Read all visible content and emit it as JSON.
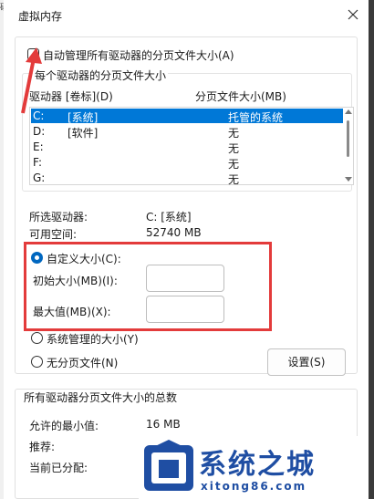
{
  "edge_glyph": "砀",
  "window": {
    "title": "虚拟内存"
  },
  "auto_manage": {
    "label": "自动管理所有驱动器的分页文件大小(A)",
    "checked": false
  },
  "drives_group": {
    "legend": "每个驱动器的分页文件大小",
    "col_drive": "驱动器 [卷标](D)",
    "col_size": "分页文件大小(MB)",
    "rows": [
      {
        "drive": "C:",
        "label": "[系统]",
        "size": "托管的系统",
        "selected": true
      },
      {
        "drive": "D:",
        "label": "[软件]",
        "size": "无",
        "selected": false
      },
      {
        "drive": "E:",
        "label": "",
        "size": "无",
        "selected": false
      },
      {
        "drive": "F:",
        "label": "",
        "size": "无",
        "selected": false
      },
      {
        "drive": "G:",
        "label": "",
        "size": "无",
        "selected": false
      }
    ]
  },
  "selected_drive": {
    "drive_label": "所选驱动器:",
    "drive_value": "C:  [系统]",
    "space_label": "可用空间:",
    "space_value": "52740 MB"
  },
  "custom_size": {
    "label": "自定义大小(C):",
    "selected": true,
    "initial_label": "初始大小(MB)(I):",
    "initial_value": "",
    "max_label": "最大值(MB)(X):",
    "max_value": ""
  },
  "system_managed": {
    "label": "系统管理的大小(Y)"
  },
  "no_paging": {
    "label": "无分页文件(N)"
  },
  "set_button": {
    "label": "设置(S)"
  },
  "totals": {
    "legend": "所有驱动器分页文件大小的总数",
    "min_label": "允许的最小值:",
    "min_value": "16 MB",
    "recommended_label": "推荐:",
    "current_label": "当前已分配:"
  },
  "watermark": {
    "title": "系统之城",
    "url": "xitong86.com"
  },
  "colors": {
    "highlight_box": "#e33b3b",
    "selection": "#0078d7",
    "radio_accent": "#0067c0",
    "watermark": "#1f4ea3"
  }
}
